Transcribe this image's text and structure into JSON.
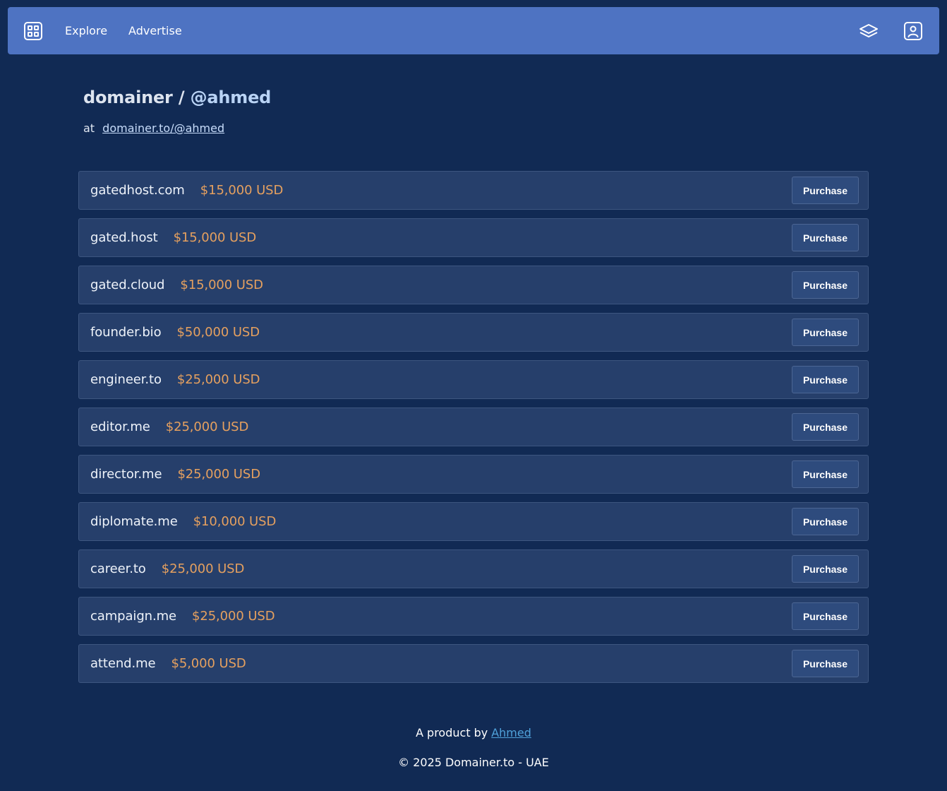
{
  "nav": {
    "logo_icon": "grid-icon",
    "links": [
      "Explore",
      "Advertise"
    ],
    "right_icons": [
      "layers-icon",
      "profile-icon"
    ]
  },
  "header": {
    "title_prefix": "domainer /",
    "title_handle": "@ahmed",
    "at_label": "at",
    "profile_link": "domainer.to/@ahmed"
  },
  "domains": [
    {
      "name": "gatedhost.com",
      "price": "$15,000 USD",
      "action": "Purchase"
    },
    {
      "name": "gated.host",
      "price": "$15,000 USD",
      "action": "Purchase"
    },
    {
      "name": "gated.cloud",
      "price": "$15,000 USD",
      "action": "Purchase"
    },
    {
      "name": "founder.bio",
      "price": "$50,000 USD",
      "action": "Purchase"
    },
    {
      "name": "engineer.to",
      "price": "$25,000 USD",
      "action": "Purchase"
    },
    {
      "name": "editor.me",
      "price": "$25,000 USD",
      "action": "Purchase"
    },
    {
      "name": "director.me",
      "price": "$25,000 USD",
      "action": "Purchase"
    },
    {
      "name": "diplomate.me",
      "price": "$10,000 USD",
      "action": "Purchase"
    },
    {
      "name": "career.to",
      "price": "$25,000 USD",
      "action": "Purchase"
    },
    {
      "name": "campaign.me",
      "price": "$25,000 USD",
      "action": "Purchase"
    },
    {
      "name": "attend.me",
      "price": "$5,000 USD",
      "action": "Purchase"
    }
  ],
  "footer": {
    "product_a": "A",
    "product_text": "product",
    "product_by": "by",
    "author": "Ahmed",
    "copyright": "© 2025",
    "brand": "Domainer.to - UAE"
  },
  "colors": {
    "background": "#112a54",
    "navbar": "#4e73c2",
    "row": "#263f6b",
    "price": "#e5a05f",
    "link": "#4fa1da"
  }
}
